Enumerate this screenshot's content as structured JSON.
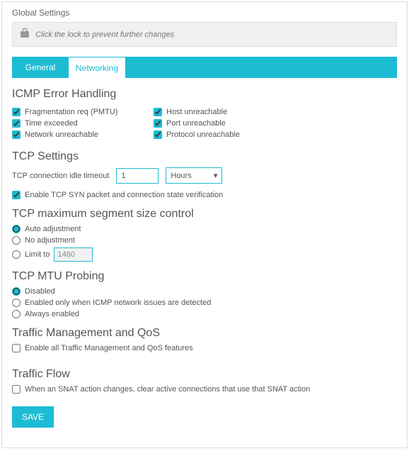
{
  "title": "Global Settings",
  "lock": {
    "message": "Click the lock to prevent further changes"
  },
  "tabs": {
    "general": "General",
    "networking": "Networking"
  },
  "icmp": {
    "heading": "ICMP Error Handling",
    "frag": "Fragmentation req (PMTU)",
    "host": "Host unreachable",
    "time": "Time exceeded",
    "port": "Port unreachable",
    "net": "Network unreachable",
    "proto": "Protocol unreachable"
  },
  "tcp": {
    "heading": "TCP Settings",
    "timeout_label": "TCP connection idle timeout",
    "timeout_value": "1",
    "timeout_unit": "Hours",
    "syn": "Enable TCP SYN packet and connection state verification"
  },
  "mss": {
    "heading": "TCP maximum segment size control",
    "auto": "Auto adjustment",
    "none": "No adjustment",
    "limit": "Limit to",
    "limit_value": "1460"
  },
  "mtu": {
    "heading": "TCP MTU Probing",
    "disabled": "Disabled",
    "auto": "Enabled only when ICMP network issues are detected",
    "always": "Always enabled"
  },
  "qos": {
    "heading": "Traffic Management and QoS",
    "enable": "Enable all Traffic Management and QoS features"
  },
  "flow": {
    "heading": "Traffic Flow",
    "snat": "When an SNAT action changes, clear active connections that use that SNAT action"
  },
  "save": "SAVE"
}
